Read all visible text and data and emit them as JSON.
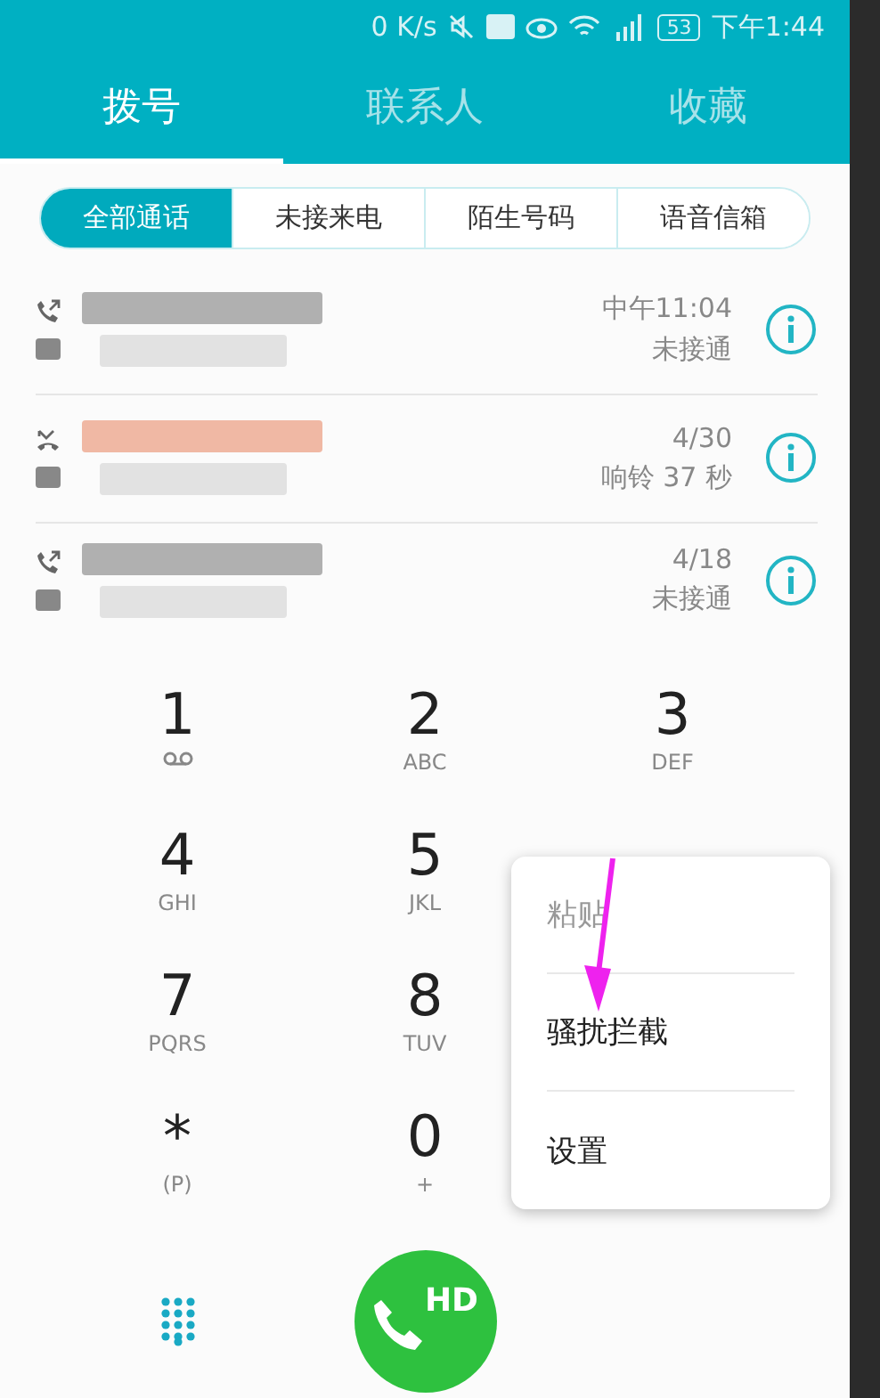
{
  "status_bar": {
    "speed": "0 K/s",
    "battery": "53",
    "time": "下午1:44"
  },
  "tabs": [
    {
      "label": "拨号",
      "selected": true
    },
    {
      "label": "联系人",
      "selected": false
    },
    {
      "label": "收藏",
      "selected": false
    }
  ],
  "filters": [
    {
      "label": "全部通话",
      "selected": true
    },
    {
      "label": "未接来电",
      "selected": false
    },
    {
      "label": "陌生号码",
      "selected": false
    },
    {
      "label": "语音信箱",
      "selected": false
    }
  ],
  "calls": [
    {
      "kind": "outgoing",
      "time": "中午11:04",
      "status": "未接通",
      "color": "#b0b0b0"
    },
    {
      "kind": "missed",
      "time": "4/30",
      "status": "响铃 37 秒",
      "color": "#f0b8a4"
    },
    {
      "kind": "outgoing",
      "time": "4/18",
      "status": "未接通",
      "color": "#b0b0b0"
    }
  ],
  "keypad": [
    {
      "digit": "1",
      "kind": "voicemail"
    },
    {
      "digit": "2",
      "letters": "ABC",
      "kind": "letters"
    },
    {
      "digit": "3",
      "letters": "DEF",
      "kind": "letters"
    },
    {
      "digit": "4",
      "letters": "GHI",
      "kind": "letters"
    },
    {
      "digit": "5",
      "letters": "JKL",
      "kind": "letters"
    },
    {
      "kind": "covered"
    },
    {
      "digit": "7",
      "letters": "PQRS",
      "kind": "letters"
    },
    {
      "digit": "8",
      "letters": "TUV",
      "kind": "letters"
    },
    {
      "kind": "covered"
    },
    {
      "digit": "*",
      "letters": "(P)",
      "kind": "letters"
    },
    {
      "digit": "0",
      "letters": "+",
      "kind": "letters"
    },
    {
      "kind": "covered"
    }
  ],
  "menu": [
    {
      "label": "粘贴",
      "disabled": true
    },
    {
      "label": "骚扰拦截",
      "disabled": false
    },
    {
      "label": "设置",
      "disabled": false
    }
  ],
  "call_button": {
    "label": "HD"
  }
}
